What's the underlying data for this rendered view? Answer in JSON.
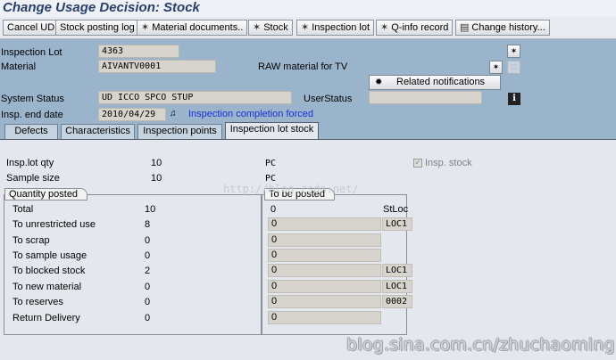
{
  "window": {
    "title": "Change Usage Decision: Stock"
  },
  "toolbar": {
    "cancel_ud": "Cancel UD",
    "stock_posting_log": "Stock posting log",
    "material_documents": "Material documents..",
    "stock": "Stock",
    "inspection_lot": "Inspection lot",
    "q_info_record": "Q-info record",
    "change_history": "Change history..."
  },
  "header": {
    "inspection_lot_label": "Inspection Lot",
    "inspection_lot_value": "4363",
    "material_label": "Material",
    "material_value": "AIVANTV0001",
    "material_desc": "RAW material for TV",
    "related_notifications": "Related notifications",
    "system_status_label": "System Status",
    "system_status_value": "UD   ICCO SPCO STUP",
    "user_status_label": "UserStatus",
    "user_status_value": "",
    "insp_end_date_label": "Insp. end date",
    "insp_end_date_value": "2010/04/29",
    "completion_text": "Inspection completion forced"
  },
  "tabs": [
    {
      "label": "Defects"
    },
    {
      "label": "Characteristics"
    },
    {
      "label": "Inspection points"
    },
    {
      "label": "Inspection lot stock"
    }
  ],
  "stock": {
    "insp_lot_qty_label": "Insp.lot qty",
    "insp_lot_qty_value": "10",
    "insp_lot_qty_unit": "PC",
    "sample_size_label": "Sample size",
    "sample_size_value": "10",
    "sample_size_unit": "PC",
    "insp_stock_label": "Insp. stock",
    "watermark_mid": "http://blog.csdn.net/",
    "quantity_posted_title": "Quantity posted",
    "to_be_posted_title": "To be posted",
    "stloc_header": "StLoc",
    "rows": [
      {
        "label": "Total",
        "posted": "10",
        "to_post": "0",
        "stloc": ""
      },
      {
        "label": "To unrestricted use",
        "posted": "8",
        "to_post": "0",
        "stloc": "LOC1"
      },
      {
        "label": "To scrap",
        "posted": "0",
        "to_post": "0",
        "stloc": ""
      },
      {
        "label": "To sample usage",
        "posted": "0",
        "to_post": "0",
        "stloc": ""
      },
      {
        "label": "To blocked stock",
        "posted": "2",
        "to_post": "0",
        "stloc": "LOC1"
      },
      {
        "label": "To new material",
        "posted": "0",
        "to_post": "0",
        "stloc": "LOC1"
      },
      {
        "label": "To reserves",
        "posted": "0",
        "to_post": "0",
        "stloc": "0002"
      },
      {
        "label": "Return Delivery",
        "posted": "0",
        "to_post": "0",
        "stloc": ""
      }
    ]
  },
  "watermark": "blog.sina.com.cn/zhuchaoming",
  "icons": {
    "material_documents": "glasses-icon",
    "stock": "glasses-icon",
    "inspection_lot": "glasses-icon",
    "q_info_record": "glasses-icon",
    "change_history": "history-icon",
    "related_notifications": "notification-icon",
    "info": "info-icon"
  }
}
